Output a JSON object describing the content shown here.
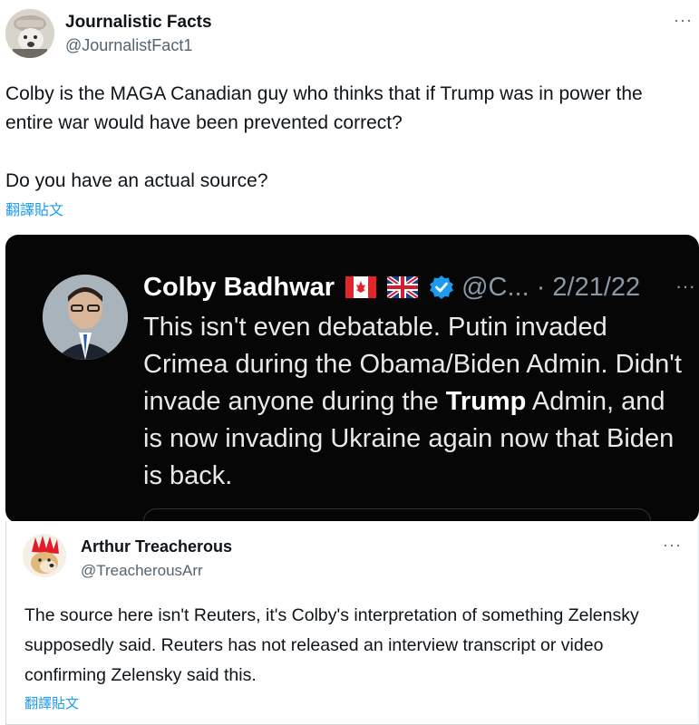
{
  "tweet": {
    "author_name": "Journalistic Facts",
    "author_handle": "@JournalistFact1",
    "more_label": "···",
    "text_line1": "Colby is the MAGA Canadian guy who thinks that if Trump was in power the entire war would have been prevented correct?",
    "text_line2": "Do you have an actual source?",
    "translate_label": "翻譯貼文"
  },
  "embedded": {
    "author_name": "Colby Badhwar",
    "flags": [
      "canada-flag",
      "uk-flag"
    ],
    "verified_icon": "verified-badge-icon",
    "handle_date": "@C... · 2/21/22",
    "edge_text": "···",
    "body_part1": "This isn't even debatable. Putin invaded Crimea during the Obama/Biden Admin. Didn't invade anyone during the ",
    "body_bold": "Trump",
    "body_part2": " Admin, and is now invading Ukraine again now that Biden is back.",
    "background_color": "#060606"
  },
  "reply": {
    "author_name": "Arthur Treacherous",
    "author_handle": "@TreacherousArr",
    "more_label": "···",
    "text": "The source here isn't Reuters, it's Colby's interpretation of something Zelensky supposedly said. Reuters has not released an interview transcript or video confirming Zelensky said this.",
    "translate_label": "翻譯貼文"
  },
  "colors": {
    "link": "#1d9bf0",
    "secondary_text": "#536471",
    "primary_text": "#0f1419"
  }
}
